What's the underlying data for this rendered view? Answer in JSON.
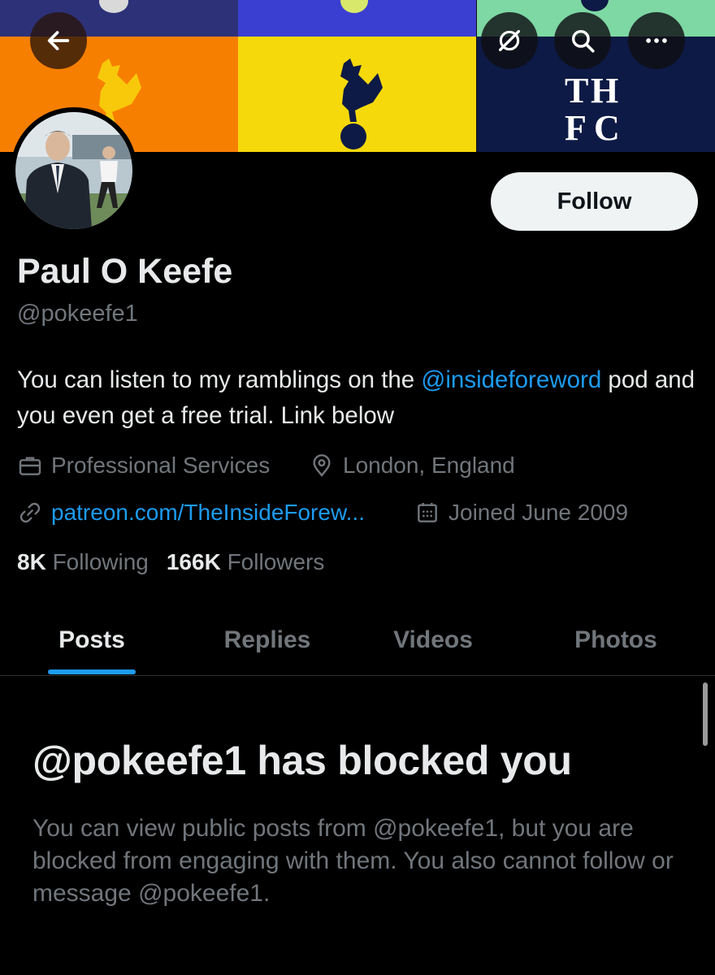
{
  "header": {
    "back_icon": "arrow-left-icon",
    "actions": [
      "grok-icon",
      "search-icon",
      "more-icon"
    ]
  },
  "banner": {
    "panel_colors": {
      "left": {
        "band": "#2d3178",
        "lower": "#f77f00"
      },
      "middle": {
        "band": "#3b3fd1",
        "lower": "#f5d90a"
      },
      "right": {
        "band": "#7ed8a3",
        "lower": "#0d1a45"
      }
    },
    "crest_text": [
      "T",
      "H",
      "F",
      "C"
    ]
  },
  "profile": {
    "name": "Paul O Keefe",
    "handle": "@pokeefe1",
    "follow_label": "Follow",
    "bio": {
      "before": "You can listen to my ramblings on the ",
      "mention": "@insideforeword",
      "after": " pod and you even get a free trial. Link below"
    },
    "category": "Professional Services",
    "location": "London, England",
    "link": "patreon.com/TheInsideForew...",
    "joined": "Joined June 2009",
    "following_count": "8K",
    "following_label": "Following",
    "followers_count": "166K",
    "followers_label": "Followers"
  },
  "tabs": [
    {
      "label": "Posts",
      "active": true
    },
    {
      "label": "Replies",
      "active": false
    },
    {
      "label": "Videos",
      "active": false
    },
    {
      "label": "Photos",
      "active": false
    }
  ],
  "blocked": {
    "title": "@pokeefe1 has blocked you",
    "message": "You can view public posts from @pokeefe1, but you are blocked from engaging with them. You also cannot follow or message @pokeefe1."
  },
  "colors": {
    "accent": "#1d9bf0",
    "text": "#e7e9ea",
    "muted": "#71767b",
    "background": "#000000"
  }
}
